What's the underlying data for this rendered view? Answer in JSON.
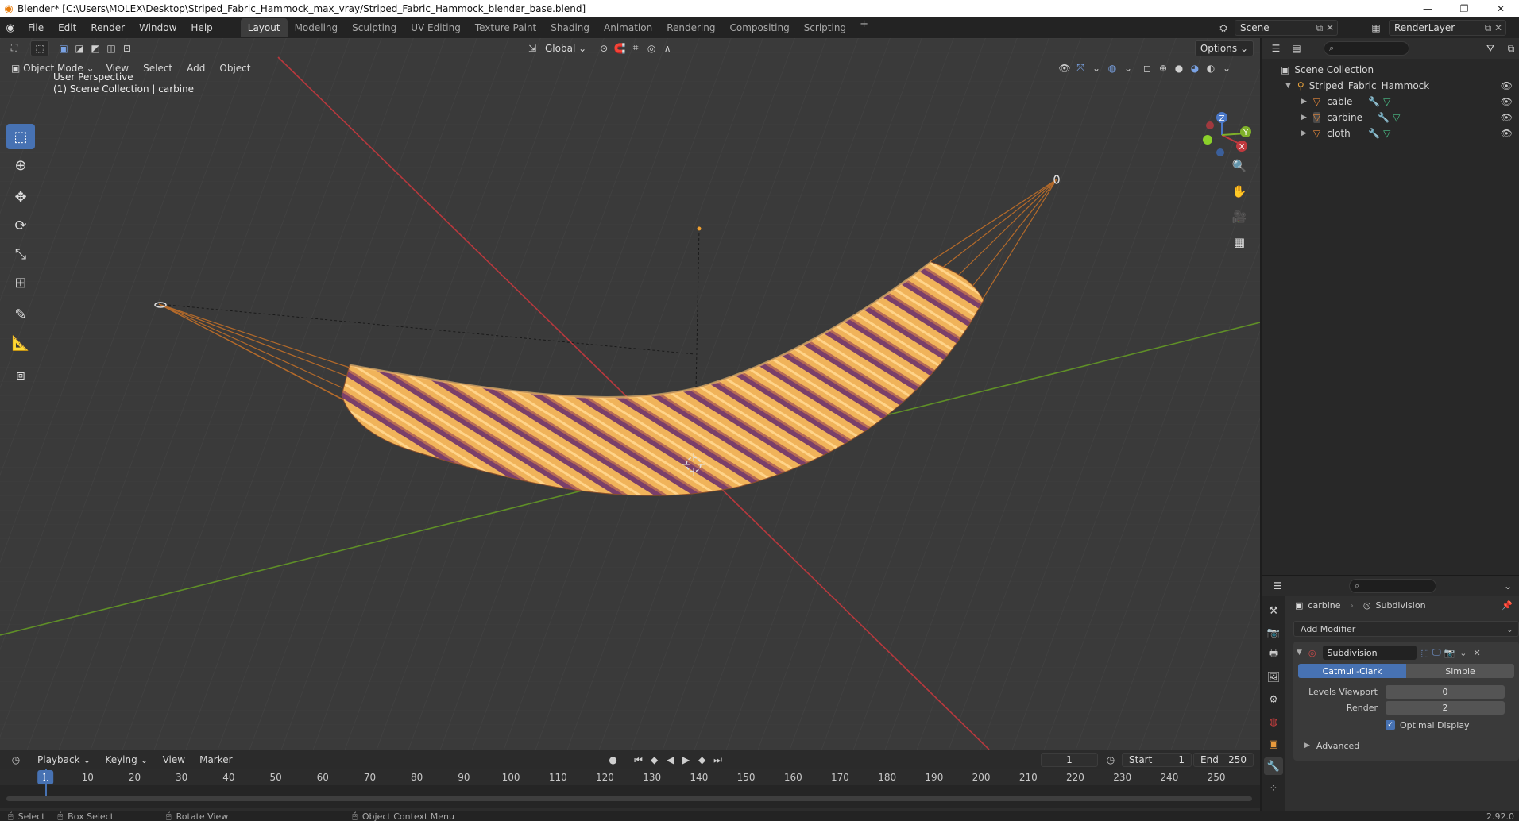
{
  "window": {
    "title": "Blender* [C:\\Users\\MOLEX\\Desktop\\Striped_Fabric_Hammock_max_vray/Striped_Fabric_Hammock_blender_base.blend]"
  },
  "menus": [
    "File",
    "Edit",
    "Render",
    "Window",
    "Help"
  ],
  "workspaces": [
    "Layout",
    "Modeling",
    "Sculpting",
    "UV Editing",
    "Texture Paint",
    "Shading",
    "Animation",
    "Rendering",
    "Compositing",
    "Scripting"
  ],
  "active_workspace": "Layout",
  "scene": "Scene",
  "render_layer": "RenderLayer",
  "viewport": {
    "transform_orientation": "Global",
    "options_label": "Options",
    "mode": "Object Mode",
    "menu": [
      "View",
      "Select",
      "Add",
      "Object"
    ],
    "perspective_label": "User Perspective",
    "collection_label": "(1) Scene Collection | carbine",
    "gizmo_axes": [
      "X",
      "Y",
      "Z"
    ]
  },
  "outliner": {
    "root": "Scene Collection",
    "collection": "Striped_Fabric_Hammock",
    "objects": [
      "cable",
      "carbine",
      "cloth"
    ]
  },
  "properties": {
    "object_name": "carbine",
    "modifier_crumb": "Subdivision",
    "add_modifier": "Add Modifier",
    "modifier_name": "Subdivision",
    "mode_options": [
      "Catmull-Clark",
      "Simple"
    ],
    "active_mode": "Catmull-Clark",
    "levels_viewport_label": "Levels Viewport",
    "levels_viewport": "0",
    "render_label": "Render",
    "render_levels": "2",
    "optimal_display": "Optimal Display",
    "advanced": "Advanced"
  },
  "timeline": {
    "menus": [
      "Playback",
      "Keying",
      "View",
      "Marker"
    ],
    "current_frame": "1",
    "start_label": "Start",
    "start": "1",
    "end_label": "End",
    "end": "250",
    "ticks": [
      "1",
      "10",
      "20",
      "30",
      "40",
      "50",
      "60",
      "70",
      "80",
      "90",
      "100",
      "110",
      "120",
      "130",
      "140",
      "150",
      "160",
      "170",
      "180",
      "190",
      "200",
      "210",
      "220",
      "230",
      "240",
      "250"
    ]
  },
  "statusbar": {
    "items": [
      "Select",
      "Box Select",
      "Rotate View",
      "Object Context Menu"
    ],
    "version": "2.92.0"
  },
  "colors": {
    "accent_blue": "#4772b3",
    "axis_x": "#c23a3a",
    "axis_y": "#6a9d2a",
    "fabric_light": "#f0b35a",
    "fabric_dark": "#6b3a6a"
  }
}
